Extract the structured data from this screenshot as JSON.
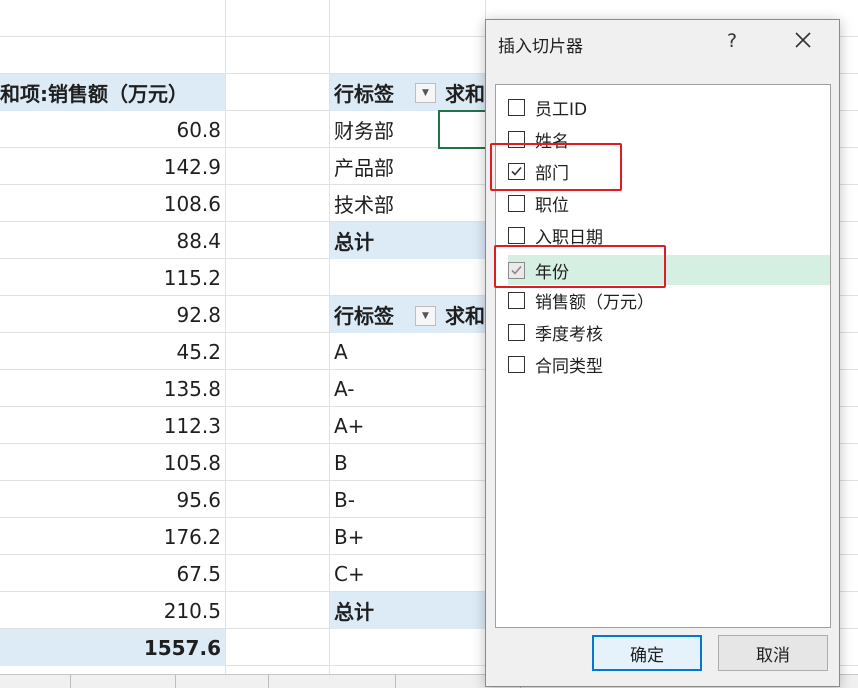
{
  "sheet": {
    "sum_header": "和项:销售额（万元）",
    "sales_values": [
      "60.8",
      "142.9",
      "108.6",
      "88.4",
      "115.2",
      "92.8",
      "45.2",
      "135.8",
      "112.3",
      "105.8",
      "95.6",
      "176.2",
      "67.5",
      "210.5"
    ],
    "sales_total": "1557.6",
    "pivot1": {
      "row_label": "行标签",
      "sum_header": "求和",
      "rows": [
        "财务部",
        "产品部",
        "技术部"
      ],
      "total": "总计"
    },
    "pivot2": {
      "row_label": "行标签",
      "sum_header": "求和",
      "rows": [
        "A",
        "A-",
        "A+",
        "B",
        "B-",
        "B+",
        "C+"
      ],
      "total": "总计"
    }
  },
  "dialog": {
    "title": "插入切片器",
    "help": "?",
    "fields": [
      {
        "label": "员工ID",
        "checked": false
      },
      {
        "label": "姓名",
        "checked": false
      },
      {
        "label": "部门",
        "checked": true
      },
      {
        "label": "职位",
        "checked": false
      },
      {
        "label": "入职日期",
        "checked": false
      },
      {
        "label": "年份",
        "checked": true
      },
      {
        "label": "销售额（万元）",
        "checked": false
      },
      {
        "label": "季度考核",
        "checked": false
      },
      {
        "label": "合同类型",
        "checked": false
      }
    ],
    "ok_label": "确定",
    "cancel_label": "取消"
  },
  "colors": {
    "header_fill": "#ddebf7",
    "highlight": "#d5efe2",
    "annotation_red": "#e11b22",
    "selection_green": "#217346"
  }
}
